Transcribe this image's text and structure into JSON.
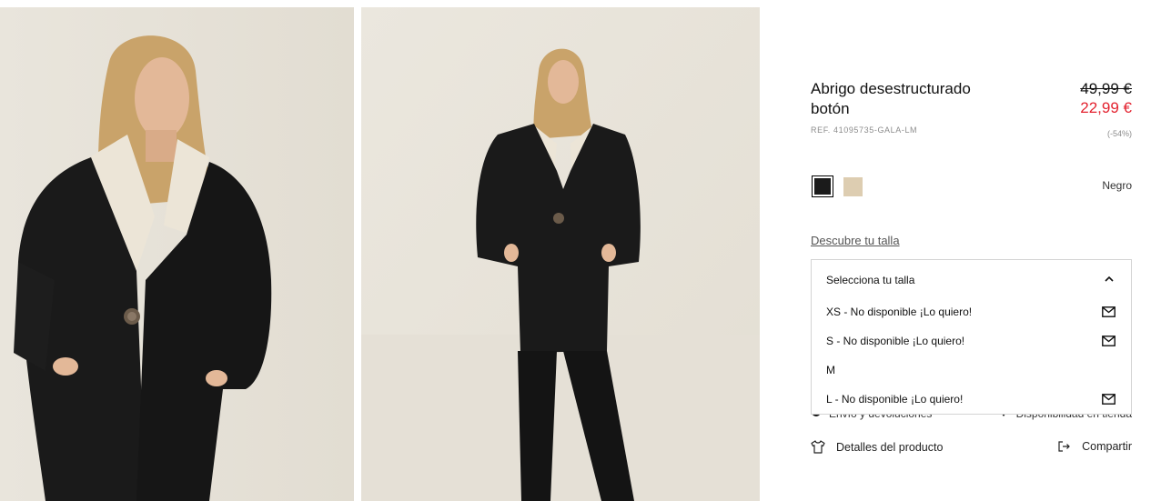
{
  "product": {
    "title": "Abrigo desestructurado botón",
    "ref": "REF. 41095735-GALA-LM",
    "price_old": "49,99 €",
    "price_new": "22,99 €",
    "discount": "(-54%)",
    "accent_sale_color": "#e3222f"
  },
  "colors": {
    "swatches": [
      {
        "name": "black",
        "hex": "#1b1b1b",
        "selected": true
      },
      {
        "name": "beige",
        "hex": "#ddcdb1",
        "selected": false
      }
    ],
    "selected_label": "Negro"
  },
  "size_guide_link": "Descubre tu talla",
  "size_dropdown": {
    "header": "Selecciona tu talla",
    "expanded": true,
    "options": [
      {
        "label": "XS - No disponible ¡Lo quiero!",
        "notify_icon": "mail-icon"
      },
      {
        "label": "S - No disponible ¡Lo quiero!",
        "notify_icon": "mail-icon"
      },
      {
        "label": "M",
        "notify_icon": ""
      },
      {
        "label": "L - No disponible ¡Lo quiero!",
        "notify_icon": "mail-icon"
      }
    ]
  },
  "links": {
    "shipping": "Envío y devoluciones",
    "store_availability": "Disponibilidad en tienda",
    "details": "Detalles del producto",
    "share": "Compartir"
  },
  "images": [
    {
      "name": "product-photo-closeup"
    },
    {
      "name": "product-photo-full"
    }
  ]
}
